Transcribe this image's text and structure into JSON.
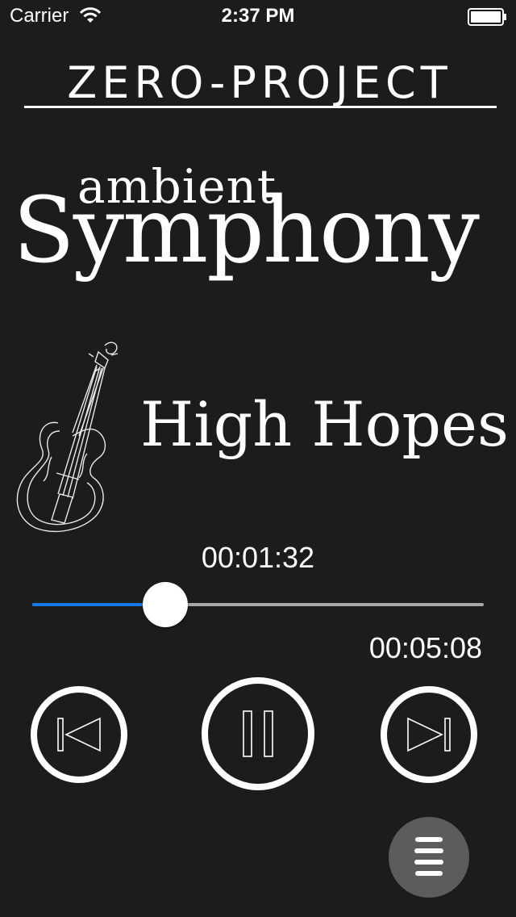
{
  "status_bar": {
    "carrier": "Carrier",
    "time": "2:37 PM",
    "wifi_icon": "wifi-icon",
    "battery_icon": "battery-icon"
  },
  "header": {
    "brand": "ZERO-PROJECT"
  },
  "album": {
    "genre": "ambient",
    "title": "Symphony"
  },
  "track": {
    "title": "High Hopes",
    "art_icon": "violin-icon"
  },
  "playback": {
    "elapsed": "00:01:32",
    "duration": "00:05:08",
    "progress_fraction": 0.295,
    "fill_color": "#1877e6",
    "track_color": "#a8a8a8"
  },
  "controls": {
    "previous_icon": "skip-previous-icon",
    "pause_icon": "pause-icon",
    "next_icon": "skip-next-icon",
    "menu_icon": "menu-icon"
  }
}
